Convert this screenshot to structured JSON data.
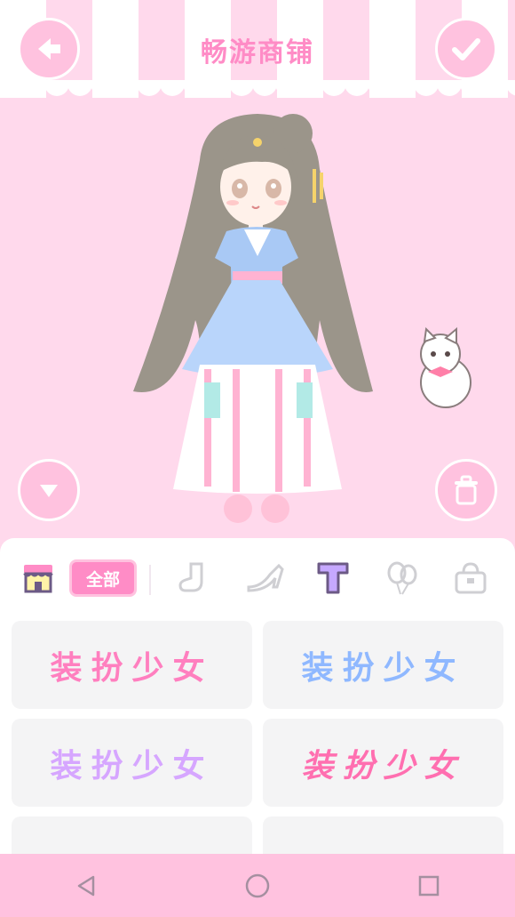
{
  "header": {
    "title": "畅游商铺"
  },
  "icons": {
    "back": "arrow-left-icon",
    "confirm": "checkmark-icon",
    "collapse": "chevron-down-icon",
    "trash": "trash-icon"
  },
  "tabs": {
    "shop_icon": "shop-icon",
    "all_label": "全部",
    "items": [
      "sock-icon",
      "high-heel-icon",
      "title-text-icon",
      "balloons-icon",
      "bag-icon"
    ],
    "selected": "title-text-icon"
  },
  "title_cards": [
    {
      "text": "装扮少女",
      "color": "#ff7fbf",
      "style": "pink-outline"
    },
    {
      "text": "装扮少女",
      "color": "#8fb8ff",
      "style": "blue-outline"
    },
    {
      "text": "装扮少女",
      "color": "#d6a6ff",
      "style": "lavender-outline"
    },
    {
      "text": "装扮少女",
      "color": "#ff6fb0",
      "style": "pink-script"
    }
  ],
  "colors": {
    "accent": "#ff8cc6",
    "background": "#ffd9ec",
    "button": "#ffc2df",
    "selected_tab": "#6c5a86"
  },
  "navbar": [
    "back-nav-icon",
    "home-nav-icon",
    "recents-nav-icon"
  ]
}
